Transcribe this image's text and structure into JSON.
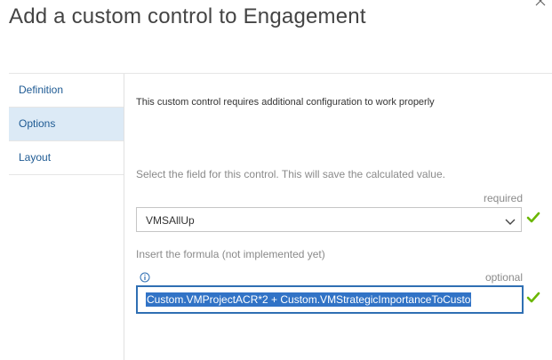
{
  "dialog": {
    "title": "Add a custom control to Engagement",
    "close_icon": "close-icon"
  },
  "nav": {
    "items": [
      {
        "label": "Definition",
        "selected": false
      },
      {
        "label": "Options",
        "selected": true
      },
      {
        "label": "Layout",
        "selected": false
      }
    ]
  },
  "options": {
    "notice": "This custom control requires additional configuration to work properly",
    "field_instruction": "Select the field for this control. This will save the calculated value.",
    "field_required_label": "required",
    "field_value": "VMSAllUp",
    "formula_label": "Insert the formula (not implemented yet)",
    "formula_optional_label": "optional",
    "formula_value": "Custom.VMProjectACR*2 + Custom.VMStrategicImportanceToCusto"
  },
  "colors": {
    "accent": "#2f6fb3",
    "selection": "#3173c6",
    "nav_selected_bg": "#dceaf6",
    "valid_check": "#6bb700"
  }
}
